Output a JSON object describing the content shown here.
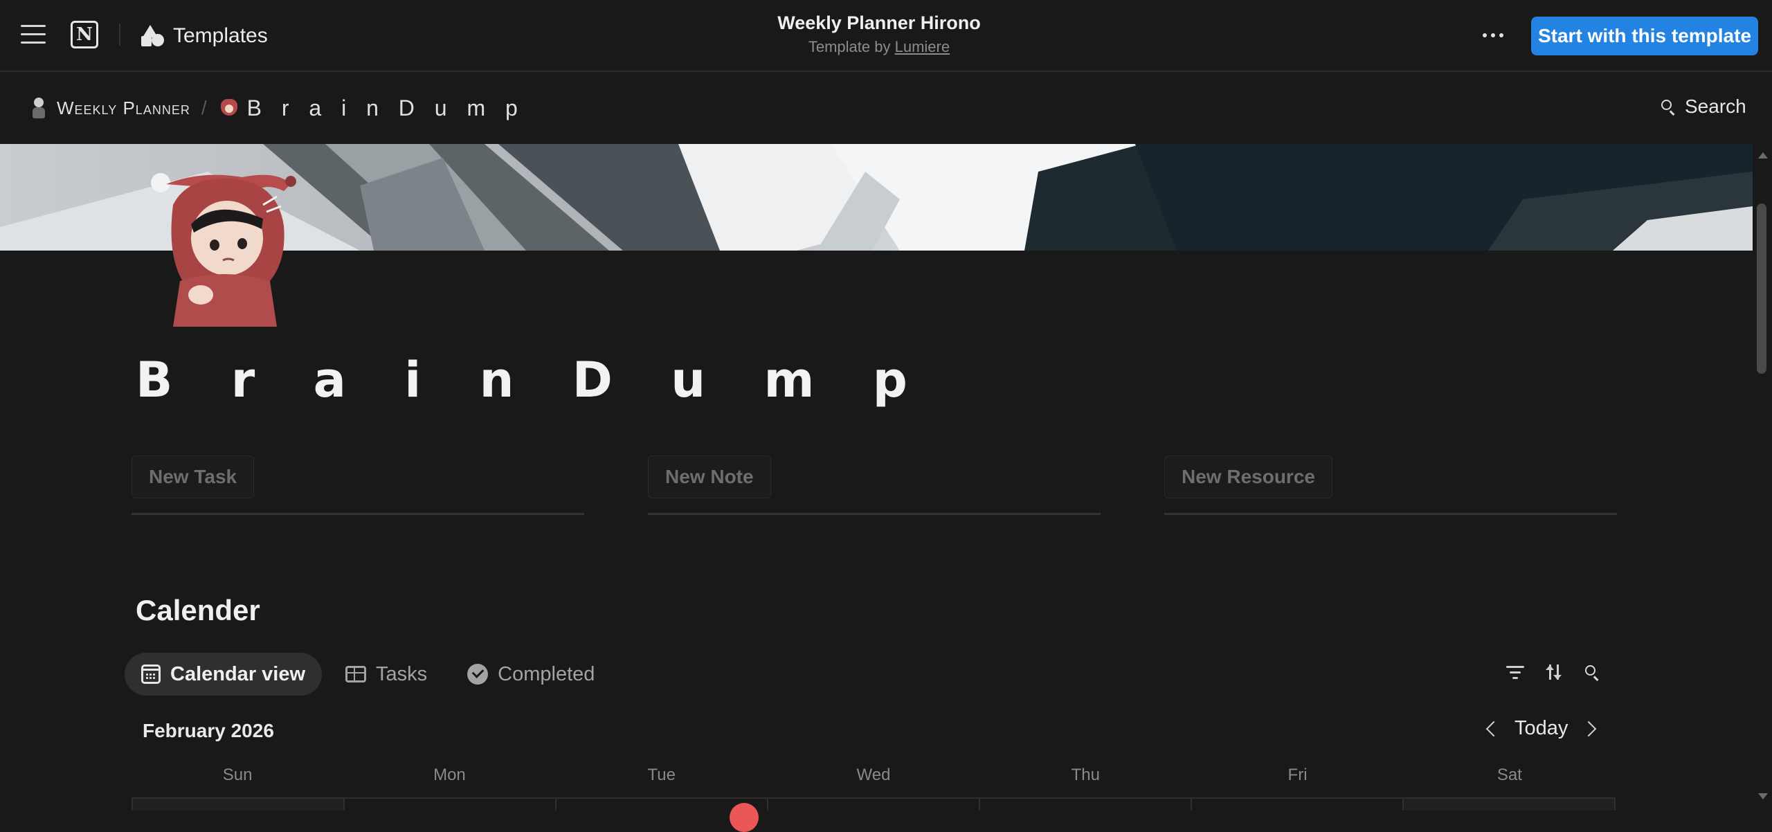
{
  "topbar": {
    "templates_label": "Templates",
    "page_title": "Weekly Planner Hirono",
    "template_by": "Template by",
    "author": "Lumiere",
    "start_button": "Start with this template"
  },
  "breadcrumb": {
    "parent": "Weekly Planner",
    "separator": "/",
    "current": "B r a i n   D u m p"
  },
  "search_label": "Search",
  "page": {
    "title": "B r a i n  D u m p"
  },
  "actions": [
    {
      "label": "New Task"
    },
    {
      "label": "New Note"
    },
    {
      "label": "New Resource"
    }
  ],
  "calendar": {
    "section_title": "Calender",
    "views": [
      {
        "label": "Calendar view",
        "icon": "calendar-icon",
        "active": true
      },
      {
        "label": "Tasks",
        "icon": "table-icon",
        "active": false
      },
      {
        "label": "Completed",
        "icon": "check-circle-icon",
        "active": false
      }
    ],
    "month": "February 2026",
    "today_label": "Today",
    "weekdays": [
      "Sun",
      "Mon",
      "Tue",
      "Wed",
      "Thu",
      "Fri",
      "Sat"
    ]
  },
  "colors": {
    "background": "#191919",
    "accent": "#2383e2",
    "today_marker": "#eb5757"
  }
}
